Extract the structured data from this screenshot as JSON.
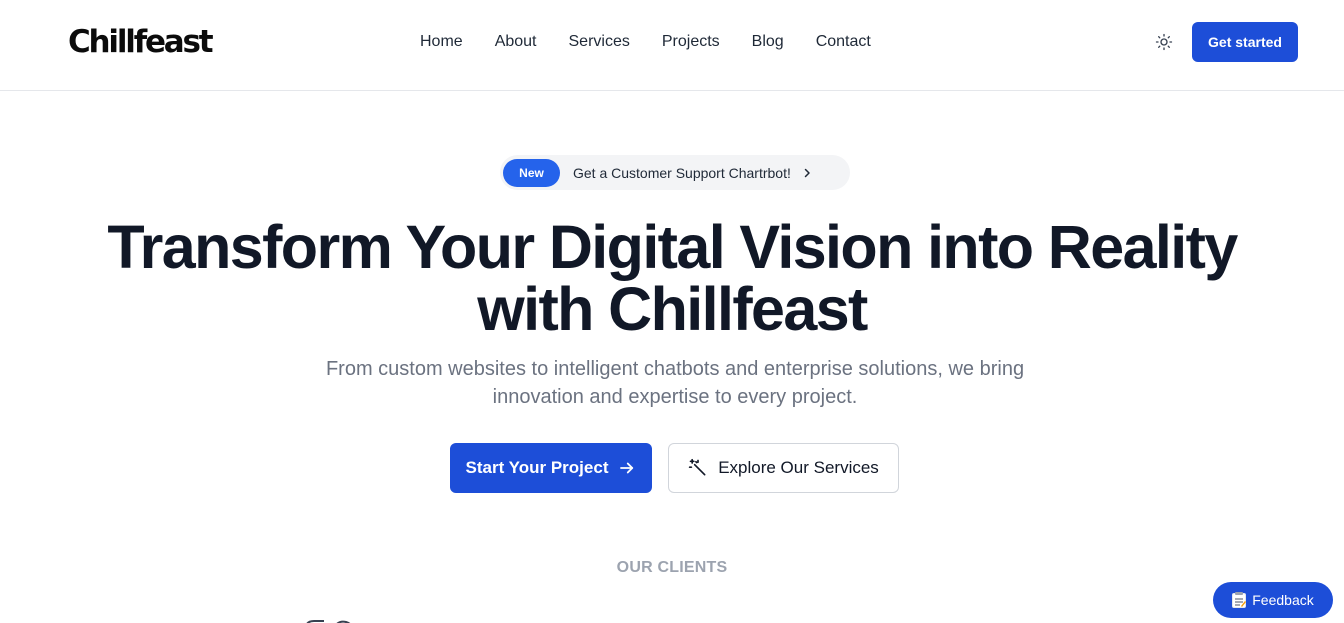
{
  "header": {
    "logo": "Chillfeast",
    "nav": [
      "Home",
      "About",
      "Services",
      "Projects",
      "Blog",
      "Contact"
    ],
    "theme_icon": "sun-icon",
    "cta_label": "Get started"
  },
  "announcement": {
    "badge": "New",
    "text": "Get a Customer Support Chartrbot!",
    "icon": "chevron-right-icon"
  },
  "hero": {
    "title_line1": "Transform Your Digital Vision into Reality",
    "title_line2": "with Chillfeast",
    "subtitle_line1": "From custom websites to intelligent chatbots and enterprise solutions, we bring",
    "subtitle_line2": "innovation and expertise to every project.",
    "primary_label": "Start Your Project",
    "primary_icon": "arrow-right-icon",
    "secondary_label": "Explore Our Services",
    "secondary_icon": "magic-wand-icon"
  },
  "clients": {
    "label": "OUR CLIENTS"
  },
  "feedback": {
    "label": "Feedback",
    "icon": "memo-icon"
  },
  "colors": {
    "primary": "#1d4ed8",
    "badge": "#2563eb",
    "heading": "#111827",
    "muted": "#6b7280",
    "clients_label": "#9ca3af"
  }
}
